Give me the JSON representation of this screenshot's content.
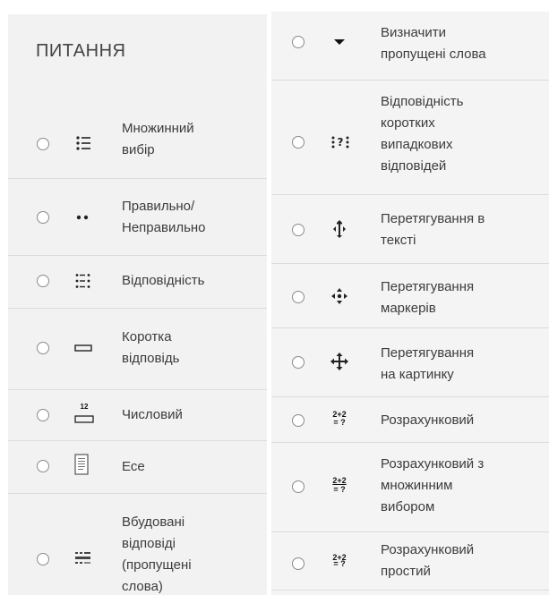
{
  "heading": "ПИТАННЯ",
  "left_items": [
    {
      "lines": [
        "Множинний",
        "вибір"
      ],
      "icon": "multichoice-icon"
    },
    {
      "lines": [
        "Правильно/",
        "Неправильно"
      ],
      "icon": "truefalse-icon"
    },
    {
      "lines": [
        "Відповідність"
      ],
      "icon": "matching-icon"
    },
    {
      "lines": [
        "Коротка",
        "відповідь"
      ],
      "icon": "shortanswer-icon"
    },
    {
      "lines": [
        "Числовий"
      ],
      "icon": "numerical-icon",
      "icon_text": "12"
    },
    {
      "lines": [
        "Есе"
      ],
      "icon": "essay-icon"
    },
    {
      "lines": [
        "Вбудовані",
        "відповіді",
        "(пропущені",
        "слова)"
      ],
      "icon": "embedded-answers-icon"
    }
  ],
  "right_items": [
    {
      "lines": [
        "Визначити",
        "пропущені слова"
      ],
      "icon": "select-missing-words-icon"
    },
    {
      "lines": [
        "Відповідність",
        "коротких",
        "випадкових",
        "відповідей"
      ],
      "icon": "random-shortanswer-matching-icon"
    },
    {
      "lines": [
        "Перетягування в",
        "тексті"
      ],
      "icon": "drag-drop-text-icon"
    },
    {
      "lines": [
        "Перетягування",
        "маркерів"
      ],
      "icon": "drag-drop-markers-icon"
    },
    {
      "lines": [
        "Перетягування",
        "на картинку"
      ],
      "icon": "drag-drop-image-icon"
    },
    {
      "lines": [
        "Розрахунковий"
      ],
      "icon": "calculated-icon",
      "icon_text": [
        "2+2",
        "= ?"
      ]
    },
    {
      "lines": [
        "Розрахунковий з",
        "множинним",
        "вибором"
      ],
      "icon": "calculated-multichoice-icon",
      "icon_text": [
        "2+2",
        "= ?"
      ]
    },
    {
      "lines": [
        "Розрахунковий",
        "простий"
      ],
      "icon": "calculated-simple-icon",
      "icon_text": [
        "2+2",
        "= ?"
      ]
    }
  ]
}
